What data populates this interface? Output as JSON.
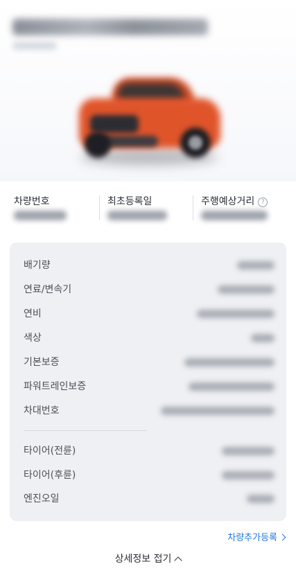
{
  "summary": {
    "plate_label": "차량번호",
    "first_registration_label": "최초등록일",
    "expected_mileage_label": "주행예상거리",
    "help_icon": "question-circle-icon"
  },
  "details": {
    "rows": [
      {
        "label": "배기량"
      },
      {
        "label": "연료/변속기"
      },
      {
        "label": "연비"
      },
      {
        "label": "색상"
      },
      {
        "label": "기본보증"
      },
      {
        "label": "파워트레인보증"
      },
      {
        "label": "차대번호"
      },
      {
        "label": "타이어(전륜)"
      },
      {
        "label": "타이어(후륜)"
      },
      {
        "label": "엔진오일"
      }
    ]
  },
  "actions": {
    "add_vehicle_label": "차량추가등록",
    "collapse_label": "상세정보 접기"
  },
  "colors": {
    "accent_link": "#1f78e0",
    "card_background": "#eef0f3",
    "car_body": "#e0542a"
  }
}
